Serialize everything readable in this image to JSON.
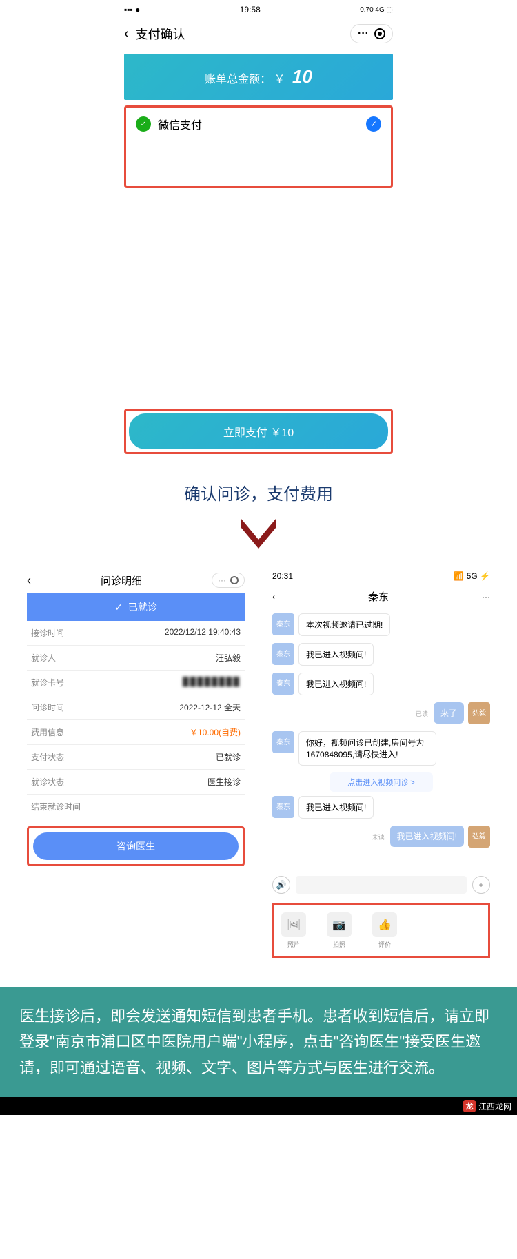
{
  "screen1": {
    "status": {
      "time": "19:58",
      "right": "0.70 4G ⬚"
    },
    "nav_title": "支付确认",
    "amount_label": "账单总金额：",
    "amount_currency": "￥",
    "amount_value": "10",
    "pay_method": "微信支付",
    "pay_button": "立即支付  ￥10"
  },
  "caption": "确认问诊，支付费用",
  "screen2": {
    "nav_title": "问诊明细",
    "status_text": "已就诊",
    "rows": [
      {
        "k": "接诊时间",
        "v": "2022/12/12 19:40:43"
      },
      {
        "k": "就诊人",
        "v": "汪弘毅"
      },
      {
        "k": "就诊卡号",
        "v": "████████"
      },
      {
        "k": "问诊时间",
        "v": "2022-12-12 全天"
      },
      {
        "k": "费用信息",
        "v": "￥10.00(自费)"
      },
      {
        "k": "支付状态",
        "v": "已就诊"
      },
      {
        "k": "就诊状态",
        "v": "医生接诊"
      },
      {
        "k": "结束就诊时间",
        "v": ""
      }
    ],
    "consult_button": "咨询医生"
  },
  "screen3": {
    "status": {
      "time": "20:31",
      "right": "5G ⚡"
    },
    "contact": "秦东",
    "avatar_other": "秦东",
    "avatar_me": "弘毅",
    "messages": [
      {
        "side": "left",
        "text": "本次视频邀请已过期!"
      },
      {
        "side": "left",
        "text": "我已进入视频间!"
      },
      {
        "side": "left",
        "text": "我已进入视频间!"
      },
      {
        "side": "right",
        "text": "来了",
        "read": "已读"
      },
      {
        "side": "left",
        "text": "你好，视频问诊已创建,房间号为1670848095,请尽快进入!"
      },
      {
        "side": "link",
        "text": "点击进入视频问诊 >"
      },
      {
        "side": "left",
        "text": "我已进入视频间!"
      },
      {
        "side": "right",
        "text": "我已进入视频间!",
        "read": "未读"
      }
    ],
    "tools": [
      {
        "icon": "🖼",
        "label": "照片"
      },
      {
        "icon": "📷",
        "label": "拍照"
      },
      {
        "icon": "👍",
        "label": "评价"
      }
    ]
  },
  "instruction": "医生接诊后，即会发送通知短信到患者手机。患者收到短信后，请立即登录\"南京市浦口区中医院用户端\"小程序，点击\"咨询医生\"接受医生邀请，即可通过语音、视频、文字、图片等方式与医生进行交流。",
  "watermark": "江西龙网"
}
